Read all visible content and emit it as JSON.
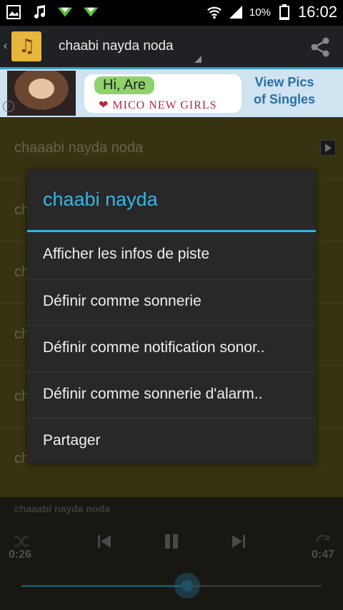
{
  "status_bar": {
    "time": "16:02",
    "battery_percent": "10%",
    "icons": [
      "image-icon",
      "music-note-icon",
      "download-arrow-icon",
      "download-arrow-icon",
      "wifi-icon",
      "signal-icon",
      "battery-icon"
    ]
  },
  "action_bar": {
    "title": "chaabi nayda noda"
  },
  "ad_banner": {
    "greeting": "Hi, Are",
    "brand": "MICO NEW GIRLS",
    "cta_line1": "View Pics",
    "cta_line2": "of Singles"
  },
  "list": {
    "items": [
      {
        "label": "chaaabi nayda noda"
      },
      {
        "label": "ch"
      },
      {
        "label": "ch"
      },
      {
        "label": "ch"
      },
      {
        "label": "ch"
      },
      {
        "label": "ch"
      }
    ]
  },
  "player": {
    "track_title": "chaaabi nayda noda",
    "elapsed": "0:26",
    "duration": "0:47",
    "progress_fraction": 0.553,
    "accent_color": "#2c6f8c"
  },
  "dialog": {
    "title": "chaabi nayda",
    "accent_color": "#33b5e5",
    "items": [
      {
        "label": "Afficher les infos de piste"
      },
      {
        "label": "Définir comme sonnerie"
      },
      {
        "label": "Définir comme notification sonor.."
      },
      {
        "label": "Définir comme sonnerie d'alarm.."
      },
      {
        "label": "Partager"
      }
    ]
  }
}
